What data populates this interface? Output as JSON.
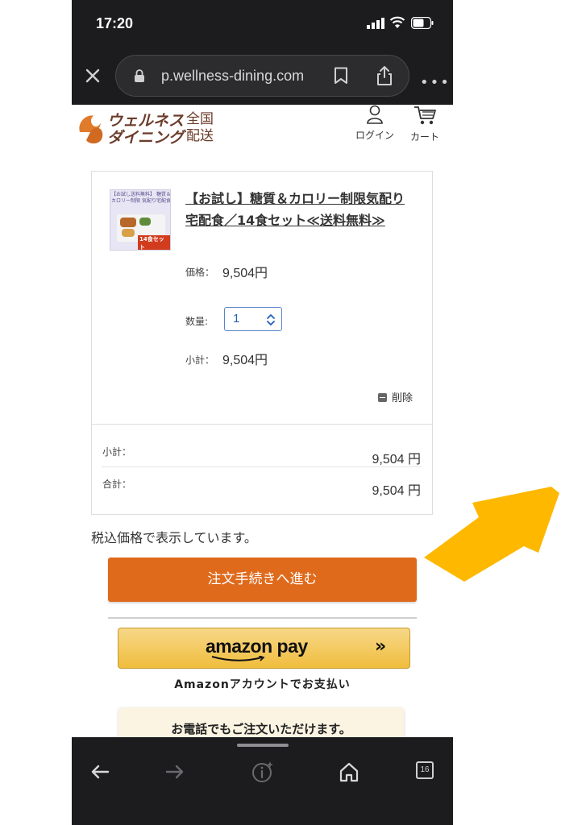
{
  "status_bar": {
    "time": "17:20"
  },
  "browser": {
    "url": "p.wellness-dining.com",
    "close_label": "×",
    "more_label": "•••"
  },
  "site": {
    "logo_text": "ウェルネス ダイニング",
    "logo_sub": "全国 配送",
    "login_label": "ログイン",
    "cart_label": "カート"
  },
  "cart": {
    "product_image_text": "【お試し送料無料】 糖質＆カロリー制限 気配り宅配食",
    "product_image_badge": "14食セット",
    "product_title": "【お試し】糖質＆カロリー制限気配り宅配食／14食セット≪送料無料≫",
    "price_label": "価格：",
    "price_value": "9,504円",
    "qty_label": "数量:",
    "qty_value": "1",
    "line_subtotal_label": "小計：",
    "line_subtotal_value": "9,504円",
    "delete_label": "削除",
    "subtotal_label": "小計：",
    "subtotal_value": "9,504 円",
    "total_label": "合計：",
    "total_value": "9,504 円"
  },
  "tax_note": "税込価格で表示しています。",
  "order_button": "注文手続きへ進む",
  "amazon": {
    "button_text": "amazon pay",
    "chevron": "»",
    "caption": "Amazonアカウントでお支払い"
  },
  "phone_order_text": "お電話でもご注文いただけます。",
  "toolbar": {
    "tab_count": "16"
  },
  "colors": {
    "order_button": "#e06a1c",
    "amazon_button": "#f0bd3d",
    "annotation_arrow": "#ffb800",
    "browser_chrome": "#1c1c1e"
  }
}
